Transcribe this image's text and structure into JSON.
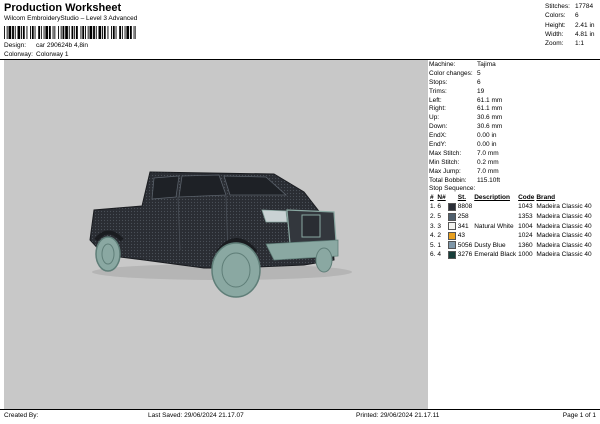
{
  "header": {
    "title": "Production Worksheet",
    "software": "Wilcom EmbroideryStudio – Level 3 Advanced",
    "design_label": "Design:",
    "design_value": "car 290624b 4,8in",
    "colorway_label": "Colorway:",
    "colorway_value": "Colorway 1"
  },
  "stats": [
    {
      "label": "Stitches:",
      "value": "17784"
    },
    {
      "label": "Colors:",
      "value": "6"
    },
    {
      "label": "Height:",
      "value": "2.41 in"
    },
    {
      "label": "Width:",
      "value": "4.81 in"
    },
    {
      "label": "Zoom:",
      "value": "1:1"
    }
  ],
  "params": [
    {
      "label": "Machine:",
      "value": "Tajima"
    },
    {
      "label": "Color changes:",
      "value": "5"
    },
    {
      "label": "Stops:",
      "value": "6"
    },
    {
      "label": "Trims:",
      "value": "19"
    },
    {
      "label": "Left:",
      "value": "61.1 mm"
    },
    {
      "label": "Right:",
      "value": "61.1 mm"
    },
    {
      "label": "Up:",
      "value": "30.6 mm"
    },
    {
      "label": "Down:",
      "value": "30.6 mm"
    },
    {
      "label": "EndX:",
      "value": "0.00 in"
    },
    {
      "label": "EndY:",
      "value": "0.00 in"
    },
    {
      "label": "Max Stitch:",
      "value": "7.0 mm"
    },
    {
      "label": "Min Stitch:",
      "value": "0.2 mm"
    },
    {
      "label": "Max Jump:",
      "value": "7.0 mm"
    },
    {
      "label": "Total Bobbin:",
      "value": "115.10ft"
    }
  ],
  "sequence": {
    "title": "Stop Sequence:",
    "headers": [
      "#",
      "N#",
      "St.",
      "Description",
      "Code",
      "Brand"
    ],
    "rows": [
      {
        "n": "1.",
        "needle": "6",
        "color": "#2b2f38",
        "st": "8808",
        "desc": "",
        "code": "1043",
        "brand": "Madeira Classic 40"
      },
      {
        "n": "2.",
        "needle": "5",
        "color": "#50606e",
        "st": "258",
        "desc": "",
        "code": "1353",
        "brand": "Madeira Classic 40"
      },
      {
        "n": "3.",
        "needle": "3",
        "color": "#f4f4f0",
        "st": "341",
        "desc": "Natural White",
        "code": "1004",
        "brand": "Madeira Classic 40"
      },
      {
        "n": "4.",
        "needle": "2",
        "color": "#e8a020",
        "st": "43",
        "desc": "",
        "code": "1024",
        "brand": "Madeira Classic 40"
      },
      {
        "n": "5.",
        "needle": "1",
        "color": "#7f97a8",
        "st": "5056",
        "desc": "Dusty Blue",
        "code": "1360",
        "brand": "Madeira Classic 40"
      },
      {
        "n": "6.",
        "needle": "4",
        "color": "#173e3a",
        "st": "3276",
        "desc": "Emerald Black",
        "code": "1000",
        "brand": "Madeira Classic 40"
      }
    ]
  },
  "footer": {
    "created_by": "Created By:",
    "last_saved": "Last Saved: 29/06/2024 21.17.07",
    "printed": "Printed: 29/06/2024 21.17.11",
    "page": "Page 1 of 1"
  },
  "colors": {
    "canvas": "#c8c8c8",
    "truck_body": "#2a2d33",
    "truck_trim": "#8aa8a2"
  }
}
